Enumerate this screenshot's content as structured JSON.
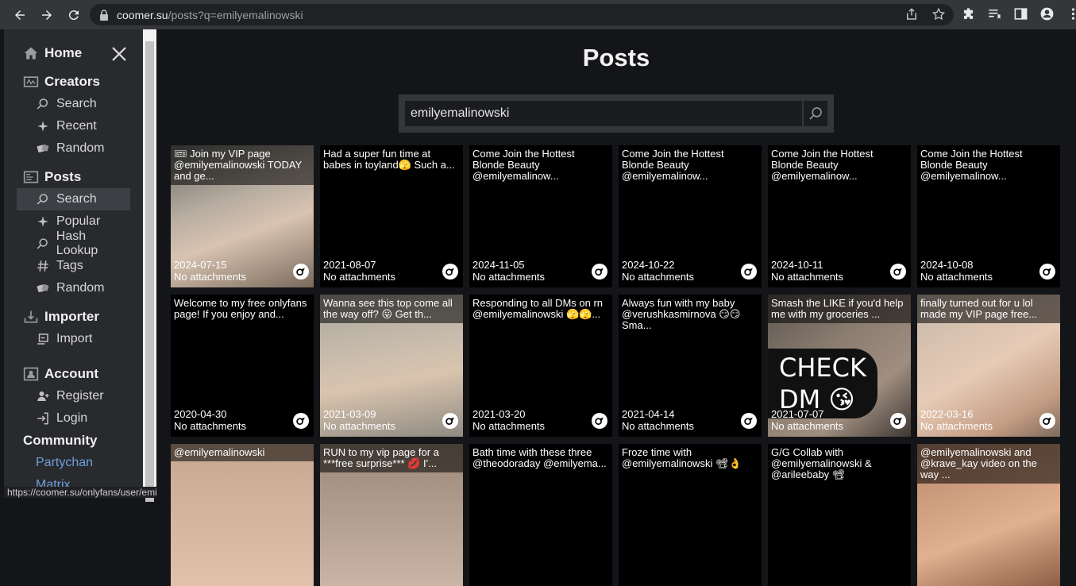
{
  "browser": {
    "url_host": "coomer.su",
    "url_path": "/posts?q=emilyemalinowski",
    "status_url": "https://coomer.su/onlyfans/user/emilyemalinowskifree/post/120210469"
  },
  "sidebar": {
    "home": "Home",
    "sections": [
      {
        "title": "Creators",
        "items": [
          "Search",
          "Recent",
          "Random"
        ]
      },
      {
        "title": "Posts",
        "items": [
          "Search",
          "Popular",
          "Hash Lookup",
          "Tags",
          "Random"
        ]
      },
      {
        "title": "Importer",
        "items": [
          "Import"
        ]
      },
      {
        "title": "Account",
        "items": [
          "Register",
          "Login"
        ]
      }
    ],
    "community": "Community",
    "links": [
      "Partychan",
      "Matrix"
    ]
  },
  "main": {
    "title": "Posts",
    "search_value": "emilyemalinowski",
    "posts": [
      {
        "title": "🎟 Join my VIP page @emilyemalinowski TODAY and ge...",
        "date": "2024-07-15",
        "attachments": "No attachments"
      },
      {
        "title": "Had a super fun time at babes in toyland🫣 Such a...",
        "date": "2021-08-07",
        "attachments": "No attachments"
      },
      {
        "title": "Come Join the Hottest Blonde Beauty @emilyemalinow...",
        "date": "2024-11-05",
        "attachments": "No attachments"
      },
      {
        "title": "Come Join the Hottest Blonde Beauty @emilyemalinow...",
        "date": "2024-10-22",
        "attachments": "No attachments"
      },
      {
        "title": "Come Join the Hottest Blonde Beauty @emilyemalinow...",
        "date": "2024-10-11",
        "attachments": "No attachments"
      },
      {
        "title": "Come Join the Hottest Blonde Beauty @emilyemalinow...",
        "date": "2024-10-08",
        "attachments": "No attachments"
      },
      {
        "title": "Welcome to my free onlyfans page! If you enjoy and...",
        "date": "2020-04-30",
        "attachments": "No attachments"
      },
      {
        "title": "Wanna see this top come all the way off? 😛 Get th...",
        "date": "2021-03-09",
        "attachments": "No attachments"
      },
      {
        "title": "Responding to all DMs on rn @emilyemalinowski 🫣🫣...",
        "date": "2021-03-20",
        "attachments": "No attachments"
      },
      {
        "title": "Always fun with my baby @verushkasmirnova 😏😏 Sma...",
        "date": "2021-04-14",
        "attachments": "No attachments"
      },
      {
        "title": "Smash the LIKE if you'd help me with my groceries ...",
        "date": "2021-07-07",
        "attachments": "No attachments"
      },
      {
        "title": "finally turned out for u lol made my VIP page free...",
        "date": "2022-03-16",
        "attachments": "No attachments"
      },
      {
        "title": "@emilyemalinowski",
        "date": "",
        "attachments": ""
      },
      {
        "title": "RUN to my vip page for a ***free surprise*** 💋 I'...",
        "date": "",
        "attachments": ""
      },
      {
        "title": "Bath time with these three @theodoraday @emilyema...",
        "date": "",
        "attachments": ""
      },
      {
        "title": "Froze time with @emilyemalinowski 📽👌",
        "date": "",
        "attachments": ""
      },
      {
        "title": "G/G Collab with @emilyemalinowski & @arileebaby 📽",
        "date": "",
        "attachments": ""
      },
      {
        "title": "@emilyemalinowski and @krave_kay video on the way ...",
        "date": "",
        "attachments": ""
      }
    ],
    "overlay_text": "CHECK DM 😘"
  }
}
